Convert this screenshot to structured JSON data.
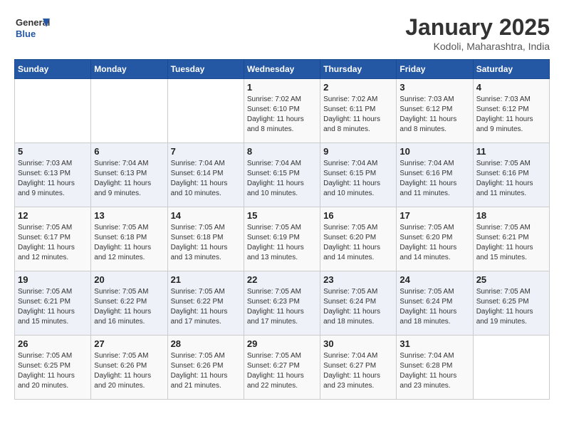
{
  "header": {
    "logo_line1": "General",
    "logo_line2": "Blue",
    "month_title": "January 2025",
    "location": "Kodoli, Maharashtra, India"
  },
  "weekdays": [
    "Sunday",
    "Monday",
    "Tuesday",
    "Wednesday",
    "Thursday",
    "Friday",
    "Saturday"
  ],
  "weeks": [
    [
      {
        "day": "",
        "info": ""
      },
      {
        "day": "",
        "info": ""
      },
      {
        "day": "",
        "info": ""
      },
      {
        "day": "1",
        "info": "Sunrise: 7:02 AM\nSunset: 6:10 PM\nDaylight: 11 hours and 8 minutes."
      },
      {
        "day": "2",
        "info": "Sunrise: 7:02 AM\nSunset: 6:11 PM\nDaylight: 11 hours and 8 minutes."
      },
      {
        "day": "3",
        "info": "Sunrise: 7:03 AM\nSunset: 6:12 PM\nDaylight: 11 hours and 8 minutes."
      },
      {
        "day": "4",
        "info": "Sunrise: 7:03 AM\nSunset: 6:12 PM\nDaylight: 11 hours and 9 minutes."
      }
    ],
    [
      {
        "day": "5",
        "info": "Sunrise: 7:03 AM\nSunset: 6:13 PM\nDaylight: 11 hours and 9 minutes."
      },
      {
        "day": "6",
        "info": "Sunrise: 7:04 AM\nSunset: 6:13 PM\nDaylight: 11 hours and 9 minutes."
      },
      {
        "day": "7",
        "info": "Sunrise: 7:04 AM\nSunset: 6:14 PM\nDaylight: 11 hours and 10 minutes."
      },
      {
        "day": "8",
        "info": "Sunrise: 7:04 AM\nSunset: 6:15 PM\nDaylight: 11 hours and 10 minutes."
      },
      {
        "day": "9",
        "info": "Sunrise: 7:04 AM\nSunset: 6:15 PM\nDaylight: 11 hours and 10 minutes."
      },
      {
        "day": "10",
        "info": "Sunrise: 7:04 AM\nSunset: 6:16 PM\nDaylight: 11 hours and 11 minutes."
      },
      {
        "day": "11",
        "info": "Sunrise: 7:05 AM\nSunset: 6:16 PM\nDaylight: 11 hours and 11 minutes."
      }
    ],
    [
      {
        "day": "12",
        "info": "Sunrise: 7:05 AM\nSunset: 6:17 PM\nDaylight: 11 hours and 12 minutes."
      },
      {
        "day": "13",
        "info": "Sunrise: 7:05 AM\nSunset: 6:18 PM\nDaylight: 11 hours and 12 minutes."
      },
      {
        "day": "14",
        "info": "Sunrise: 7:05 AM\nSunset: 6:18 PM\nDaylight: 11 hours and 13 minutes."
      },
      {
        "day": "15",
        "info": "Sunrise: 7:05 AM\nSunset: 6:19 PM\nDaylight: 11 hours and 13 minutes."
      },
      {
        "day": "16",
        "info": "Sunrise: 7:05 AM\nSunset: 6:20 PM\nDaylight: 11 hours and 14 minutes."
      },
      {
        "day": "17",
        "info": "Sunrise: 7:05 AM\nSunset: 6:20 PM\nDaylight: 11 hours and 14 minutes."
      },
      {
        "day": "18",
        "info": "Sunrise: 7:05 AM\nSunset: 6:21 PM\nDaylight: 11 hours and 15 minutes."
      }
    ],
    [
      {
        "day": "19",
        "info": "Sunrise: 7:05 AM\nSunset: 6:21 PM\nDaylight: 11 hours and 15 minutes."
      },
      {
        "day": "20",
        "info": "Sunrise: 7:05 AM\nSunset: 6:22 PM\nDaylight: 11 hours and 16 minutes."
      },
      {
        "day": "21",
        "info": "Sunrise: 7:05 AM\nSunset: 6:22 PM\nDaylight: 11 hours and 17 minutes."
      },
      {
        "day": "22",
        "info": "Sunrise: 7:05 AM\nSunset: 6:23 PM\nDaylight: 11 hours and 17 minutes."
      },
      {
        "day": "23",
        "info": "Sunrise: 7:05 AM\nSunset: 6:24 PM\nDaylight: 11 hours and 18 minutes."
      },
      {
        "day": "24",
        "info": "Sunrise: 7:05 AM\nSunset: 6:24 PM\nDaylight: 11 hours and 18 minutes."
      },
      {
        "day": "25",
        "info": "Sunrise: 7:05 AM\nSunset: 6:25 PM\nDaylight: 11 hours and 19 minutes."
      }
    ],
    [
      {
        "day": "26",
        "info": "Sunrise: 7:05 AM\nSunset: 6:25 PM\nDaylight: 11 hours and 20 minutes."
      },
      {
        "day": "27",
        "info": "Sunrise: 7:05 AM\nSunset: 6:26 PM\nDaylight: 11 hours and 20 minutes."
      },
      {
        "day": "28",
        "info": "Sunrise: 7:05 AM\nSunset: 6:26 PM\nDaylight: 11 hours and 21 minutes."
      },
      {
        "day": "29",
        "info": "Sunrise: 7:05 AM\nSunset: 6:27 PM\nDaylight: 11 hours and 22 minutes."
      },
      {
        "day": "30",
        "info": "Sunrise: 7:04 AM\nSunset: 6:27 PM\nDaylight: 11 hours and 23 minutes."
      },
      {
        "day": "31",
        "info": "Sunrise: 7:04 AM\nSunset: 6:28 PM\nDaylight: 11 hours and 23 minutes."
      },
      {
        "day": "",
        "info": ""
      }
    ]
  ]
}
